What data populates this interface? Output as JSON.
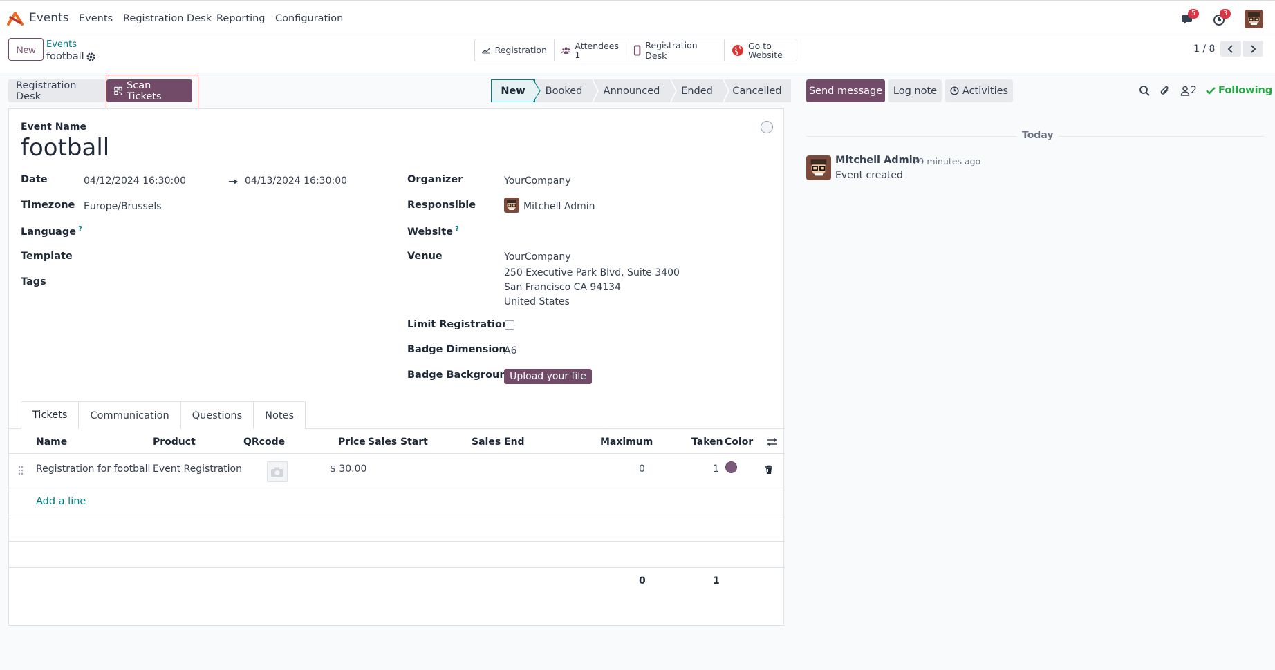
{
  "navbar": {
    "app_name": "Events",
    "menu": [
      "Events",
      "Registration Desk",
      "Reporting",
      "Configuration"
    ],
    "messages_badge": "5",
    "activities_badge": "3"
  },
  "control": {
    "new_label": "New",
    "breadcrumb_parent": "Events",
    "breadcrumb_current": "football",
    "smart_buttons": {
      "registration": "Registration",
      "attendees_label": "Attendees",
      "attendees_count": "1",
      "registration_desk": "Registration Desk",
      "go_to_line1": "Go to",
      "go_to_line2": "Website"
    },
    "pager": "1 / 8"
  },
  "header": {
    "registration_desk": "Registration Desk",
    "scan_tickets": "Scan Tickets",
    "stages": [
      "New",
      "Booked",
      "Announced",
      "Ended",
      "Cancelled"
    ],
    "active_stage": "New"
  },
  "chatter": {
    "send_message": "Send message",
    "log_note": "Log note",
    "activities": "Activities",
    "followers_count": "2",
    "following": "Following",
    "date_separator": "Today",
    "message_author": "Mitchell Admin",
    "message_time": "- 29 minutes ago",
    "message_body": "Event created"
  },
  "form": {
    "event_name_label": "Event Name",
    "event_name": "football",
    "date_label": "Date",
    "date_begin": "04/12/2024 16:30:00",
    "date_end": "04/13/2024 16:30:00",
    "timezone_label": "Timezone",
    "timezone": "Europe/Brussels",
    "language_label": "Language",
    "template_label": "Template",
    "tags_label": "Tags",
    "organizer_label": "Organizer",
    "organizer": "YourCompany",
    "responsible_label": "Responsible",
    "responsible": "Mitchell Admin",
    "website_label": "Website",
    "venue_label": "Venue",
    "venue_lines": [
      "YourCompany",
      "250 Executive Park Blvd, Suite 3400",
      "San Francisco CA 94134",
      "United States"
    ],
    "limit_label": "Limit Registrations",
    "badge_dim_label": "Badge Dimension",
    "badge_dim": "A6",
    "badge_bg_label": "Badge Background",
    "upload_label": "Upload your file"
  },
  "tabs": [
    "Tickets",
    "Communication",
    "Questions",
    "Notes"
  ],
  "tickets": {
    "columns": [
      "Name",
      "Product",
      "QRcode",
      "Price",
      "Sales Start",
      "Sales End",
      "Maximum",
      "Taken",
      "Color"
    ],
    "rows": [
      {
        "name": "Registration for football",
        "product": "Event Registration",
        "price": "$ 30.00",
        "maximum": "0",
        "taken": "1",
        "color": "#7c5a7a"
      }
    ],
    "add_line": "Add a line",
    "total_maximum": "0",
    "total_taken": "1"
  },
  "colors": {
    "primary": "#714B67",
    "link": "#017e84",
    "following": "#28a745"
  }
}
